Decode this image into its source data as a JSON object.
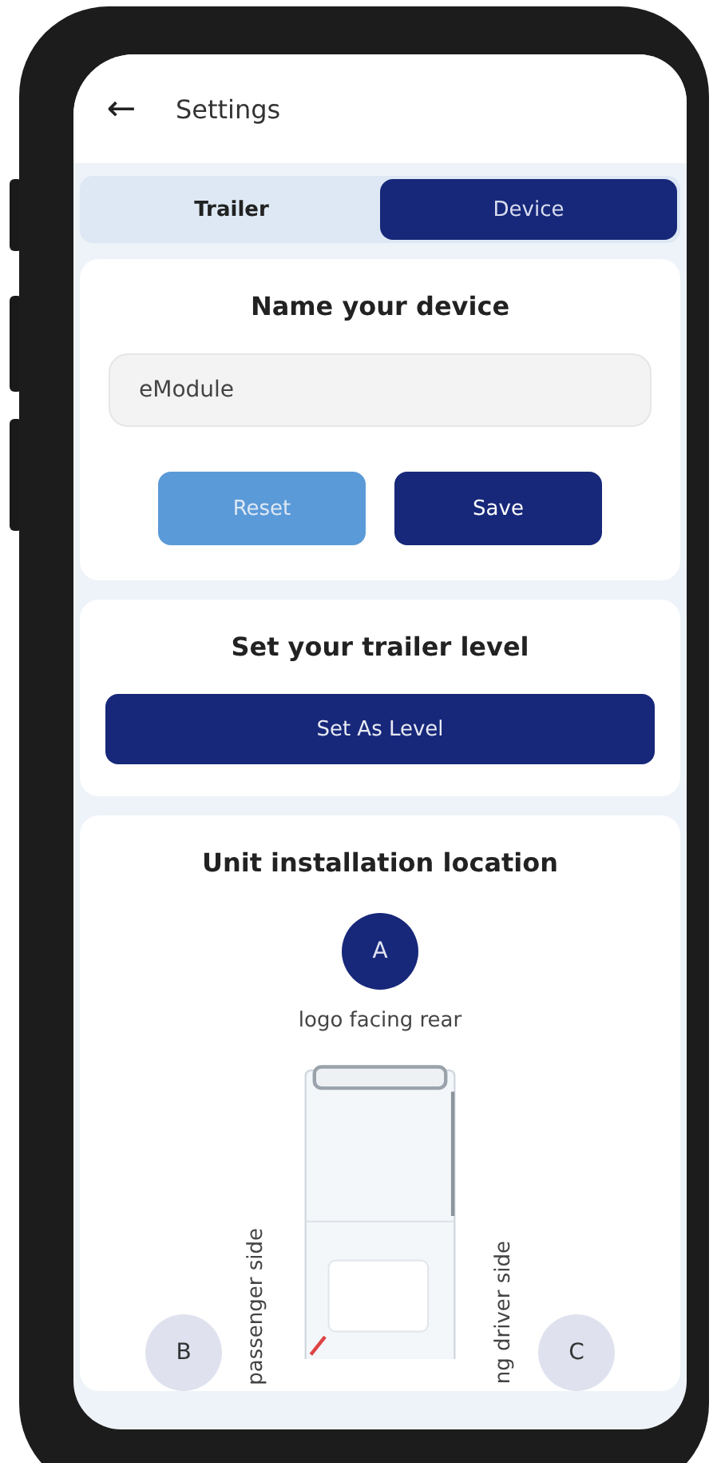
{
  "header": {
    "back_icon": "←",
    "title": "Settings"
  },
  "tabs": [
    {
      "label": "Trailer",
      "selected": false
    },
    {
      "label": "Device",
      "selected": true
    }
  ],
  "name_card": {
    "title": "Name your device",
    "field": {
      "value": "eModule"
    },
    "buttons": [
      {
        "label": "Reset",
        "kind": "secondary"
      },
      {
        "label": "Save",
        "kind": "primary"
      }
    ]
  },
  "level_card": {
    "title": "Set your trailer level",
    "button": "Set As Level"
  },
  "location_card": {
    "title": "Unit installation location",
    "top_option": {
      "letter": "A",
      "selected": true,
      "caption": "logo facing rear"
    },
    "left_option": {
      "letter": "B",
      "selected": false,
      "caption": "passenger side"
    },
    "right_option": {
      "letter": "C",
      "selected": false,
      "caption": "ng driver side"
    }
  }
}
